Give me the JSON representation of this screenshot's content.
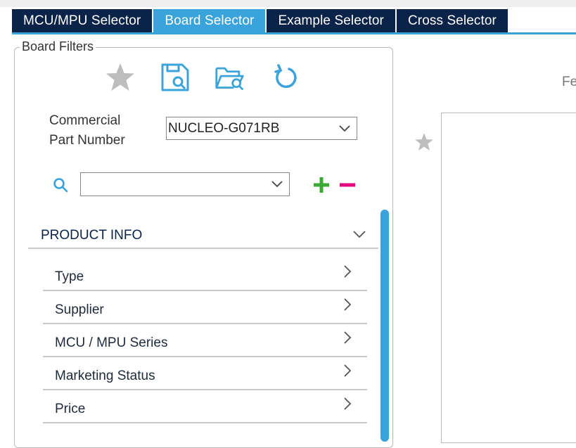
{
  "tabs": [
    {
      "label": "MCU/MPU Selector",
      "active": false
    },
    {
      "label": "Board Selector",
      "active": true
    },
    {
      "label": "Example Selector",
      "active": false
    },
    {
      "label": "Cross Selector",
      "active": false
    }
  ],
  "filters": {
    "legend": "Board Filters",
    "toolbar_icons": [
      "star-icon",
      "save-search-icon",
      "open-folder-search-icon",
      "reset-icon"
    ],
    "commercial_part_number": {
      "label": "Commercial Part Number",
      "value": "NUCLEO-G071RB"
    },
    "search": {
      "value": "",
      "placeholder": ""
    },
    "product_info": {
      "title": "PRODUCT INFO",
      "items": [
        {
          "label": "Type"
        },
        {
          "label": "Supplier"
        },
        {
          "label": "MCU / MPU Series"
        },
        {
          "label": "Marketing Status"
        },
        {
          "label": "Price"
        }
      ]
    }
  },
  "right_panel": {
    "features_label_partial": "Fe"
  },
  "colors": {
    "tab_dark": "#0b2348",
    "tab_active": "#3aa3dc",
    "add": "#3aaa35",
    "remove": "#e6007e",
    "icon_gray": "#bdbdbd"
  }
}
